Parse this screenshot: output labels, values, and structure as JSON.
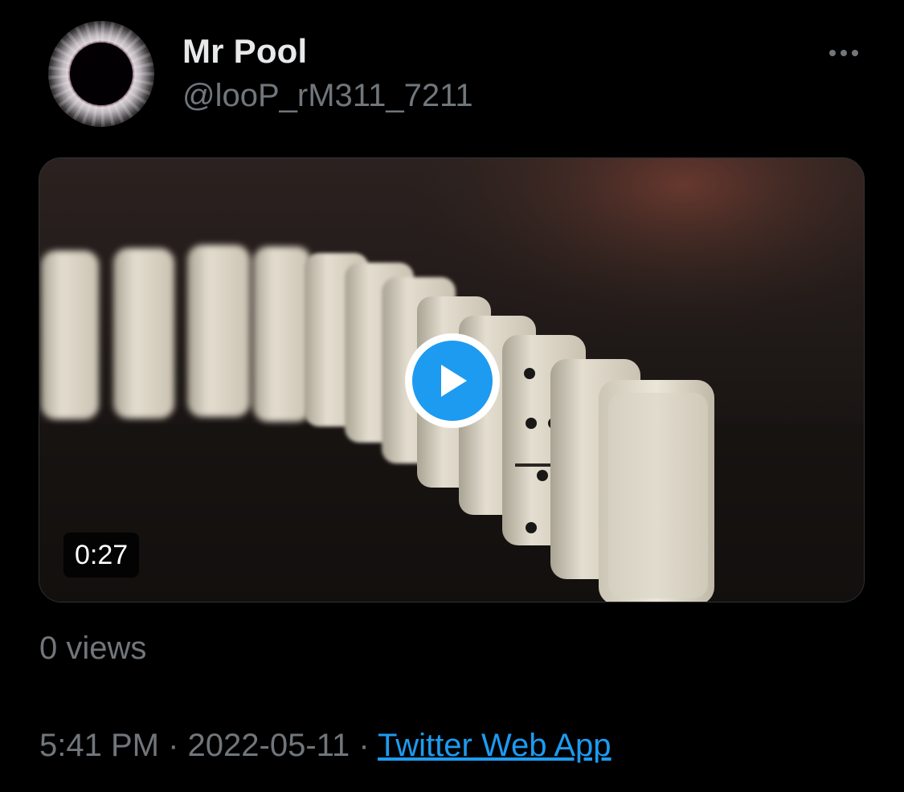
{
  "author": {
    "display_name": "Mr Pool",
    "handle": "@looP_rM311_7211",
    "avatar": "eclipse-avatar"
  },
  "menu": {
    "icon": "more-horizontal-icon"
  },
  "media": {
    "type": "video",
    "thumbnail": "row of falling dominoes",
    "duration": "0:27",
    "play_icon": "play-icon"
  },
  "stats": {
    "views": "0 views"
  },
  "meta": {
    "time": "5:41 PM",
    "separator": "·",
    "date": "2022-05-11",
    "source": "Twitter Web App"
  },
  "colors": {
    "background": "#000000",
    "primary_text": "#e7e9ea",
    "secondary_text": "#71767b",
    "accent": "#1d9bf0"
  }
}
